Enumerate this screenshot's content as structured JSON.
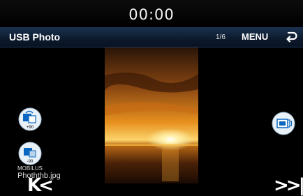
{
  "status": {
    "clock": "00:00"
  },
  "header": {
    "title": "USB Photo",
    "page_counter": "1/6",
    "menu_label": "MENU",
    "back_icon": "back-arrow-icon"
  },
  "sidebar_left": {
    "rotate_cw_label": "+90",
    "rotate_ccw_label": "-90",
    "prev_label": "K<"
  },
  "sidebar_right": {
    "slideshow_icon": "slideshow-icon",
    "next_label": ">>|"
  },
  "file": {
    "folder": "MOBILUS",
    "name": "Phoththb.jpg"
  },
  "colors": {
    "title_bar": "#12263f",
    "icon_bg": "#e9f1f8",
    "icon_blue": "#0a66c0"
  }
}
